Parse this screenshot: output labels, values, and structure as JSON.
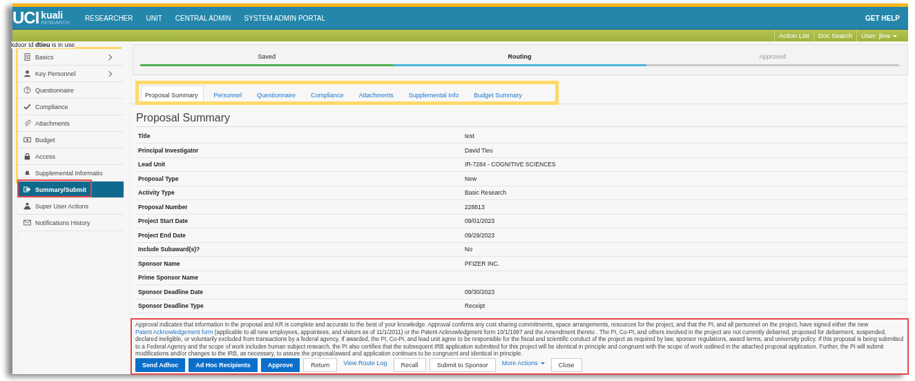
{
  "header": {
    "logo_main": "UCI",
    "logo_brand": "kuali",
    "logo_sub": "RESEARCH",
    "nav": [
      {
        "label": "RESEARCHER"
      },
      {
        "label": "UNIT"
      },
      {
        "label": "CENTRAL ADMIN"
      },
      {
        "label": "SYSTEM ADMIN PORTAL"
      }
    ],
    "help": "GET HELP"
  },
  "subbar": {
    "links": [
      {
        "label": "Action List",
        "dropdown": false
      },
      {
        "label": "Doc Search",
        "dropdown": false
      },
      {
        "label": "User: jlew",
        "dropdown": true
      }
    ]
  },
  "notice": "kdoor Id **dtieu** is in use",
  "sidebar": {
    "groups": [
      {
        "highlight": {
          "color": "#ffd966"
        },
        "items": [
          {
            "label": "Basics",
            "kind": "document",
            "expandable": true,
            "selected": false
          },
          {
            "label": "Key Personnel",
            "kind": "person",
            "expandable": true,
            "selected": false
          },
          {
            "label": "Questionnaire",
            "kind": "question",
            "expandable": false,
            "selected": false
          },
          {
            "label": "Compliance",
            "kind": "check",
            "expandable": false,
            "selected": false
          },
          {
            "label": "Attachments",
            "kind": "paperclip",
            "expandable": false,
            "selected": false
          },
          {
            "label": "Budget",
            "kind": "money",
            "expandable": false,
            "selected": false
          },
          {
            "label": "Access",
            "kind": "lock",
            "expandable": false,
            "selected": false
          },
          {
            "label": "Supplemental Informatio",
            "kind": "bell",
            "expandable": false,
            "selected": false
          }
        ]
      },
      {
        "items": [
          {
            "label": "Summary/Submit",
            "kind": "exit",
            "expandable": false,
            "selected": true,
            "highlight": {
              "color": "#e84545"
            }
          },
          {
            "label": "Super User Actions",
            "kind": "user-desk",
            "expandable": false,
            "selected": false
          },
          {
            "label": "Notifications History",
            "kind": "envelope",
            "expandable": false,
            "selected": false
          }
        ]
      }
    ]
  },
  "progress": [
    {
      "label": "Saved",
      "kind": "done"
    },
    {
      "label": "Routing",
      "kind": "current"
    },
    {
      "label": "Approved",
      "kind": "pending"
    }
  ],
  "tabs": {
    "highlight": {
      "color": "#ffd966"
    },
    "items": [
      {
        "label": "Proposal Summary",
        "selected": true
      },
      {
        "label": "Personnel",
        "selected": false
      },
      {
        "label": "Questionnaire",
        "selected": false
      },
      {
        "label": "Compliance",
        "selected": false
      },
      {
        "label": "Attachments",
        "selected": false
      },
      {
        "label": "Supplemental Info",
        "selected": false
      },
      {
        "label": "Budget Summary",
        "selected": false
      }
    ]
  },
  "section_title": "Proposal Summary",
  "summary": [
    {
      "label": "Title",
      "value": "test"
    },
    {
      "label": "Principal Investigator",
      "value": "David Tieu"
    },
    {
      "label": "Lead Unit",
      "value": "IR-7284 - COGNITIVE SCIENCES"
    },
    {
      "label": "Proposal Type",
      "value": "New"
    },
    {
      "label": "Activity Type",
      "value": "Basic Research"
    },
    {
      "label": "Proposal Number",
      "value": "228813"
    },
    {
      "label": "Project Start Date",
      "value": "09/01/2023"
    },
    {
      "label": "Project End Date",
      "value": "09/29/2023"
    },
    {
      "label": "Include Subaward(s)?",
      "value": "No"
    },
    {
      "label": "Sponsor Name",
      "value": "PFIZER INC."
    },
    {
      "label": "Prime Sponsor Name"
    },
    {
      "label": "Sponsor Deadline Date",
      "value": "09/30/2023"
    },
    {
      "label": "Sponsor Deadline Type",
      "value": "Receipt"
    }
  ],
  "action_panel": {
    "highlight": {
      "color": "#e84545"
    },
    "text_before": "Approval indicates that information in the proposal and KR is complete and accurate to the best of your knowledge. Approval confirms any cost sharing commitments, space arrangements, resources for the project, and that the PI, and all personnel on the project, have signed either the new ",
    "link": "Patent Acknowledgement form",
    "text_after": " (applicable to all new employees, appointees, and visitors as of 11/1/2011) or the Patent Acknowledgment form 10/1/1997 and the Amendment thereto . The PI, Co-PI, and others involved in the project are not currently debarred, proposed for debarment, suspended, declared ineligible, or voluntarily excluded from transactions by a federal agency. If awarded, the PI, Co-PI, and lead unit agree to be responsible for the fiscal and scientific conduct of the project as required by law, sponsor regulations, award terms, and university policy. If this proposal is being submitted to a Federal Agency and the scope of work includes human subject research, the PI also certifies that the subsequent IRB application submitted for this project will be identical in principle and congruent with the scope of work outlined in the attached proposal application. Further, the PI will submit modifications and/or changes to the IRB, as necessary, to assure the proposal/award and application continues to be congruent and identical in principle.",
    "buttons": [
      {
        "label": "Send Adhoc",
        "kind": "primary"
      },
      {
        "label": "Ad Hoc Recipients",
        "kind": "primary"
      },
      {
        "label": "Approve",
        "kind": "primary"
      },
      {
        "label": "Return",
        "kind": "plain"
      },
      {
        "label": "View Route Log",
        "kind": "link"
      },
      {
        "label": "Recall",
        "kind": "plain"
      },
      {
        "label": "Submit to Sponsor",
        "kind": "plain"
      },
      {
        "label": "More Actions",
        "kind": "menu"
      },
      {
        "label": "Close",
        "kind": "plain"
      }
    ]
  }
}
